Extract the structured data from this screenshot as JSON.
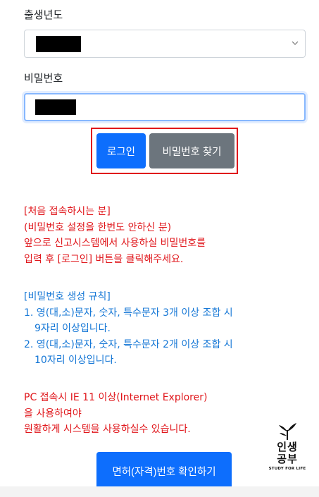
{
  "birth_year": {
    "label": "출생년도",
    "value_redacted": true
  },
  "password": {
    "label": "비밀번호",
    "value_redacted": true
  },
  "buttons": {
    "login": "로그인",
    "find_password": "비밀번호 찾기",
    "license_check": "면허(자격)번호 확인하기"
  },
  "notice_first_login": [
    "[처음 접속하시는 분]",
    "(비밀번호 설정을 한번도 안하신 분)",
    "앞으로 신고시스템에서 사용하실 비밀번호를",
    "입력 후 [로그인] 버튼을 클릭해주세요."
  ],
  "password_rules": {
    "title": "[비밀번호 생성 규칙]",
    "rule1_line1": "1. 영(대,소)문자, 숫자, 특수문자 3개 이상 조합 시",
    "rule1_line2": "9자리 이상입니다.",
    "rule2_line1": "2. 영(대,소)문자, 숫자, 특수문자 2개 이상 조합 시",
    "rule2_line2": "10자리 이상입니다."
  },
  "notice_pc": [
    "PC 접속시 IE 11 이상(Internet Explorer)",
    "을 사용하여야",
    "원활하게 시스템을 사용하실수 있습니다."
  ],
  "logo": {
    "line1": "인생",
    "line2": "공부",
    "tagline": "STUDY FOR LIFE"
  },
  "colors": {
    "primary": "#0d6efd",
    "secondary": "#6c757d",
    "notice_red": "#e0161b",
    "notice_blue": "#1577d6",
    "highlight_outline": "#e0161b"
  }
}
